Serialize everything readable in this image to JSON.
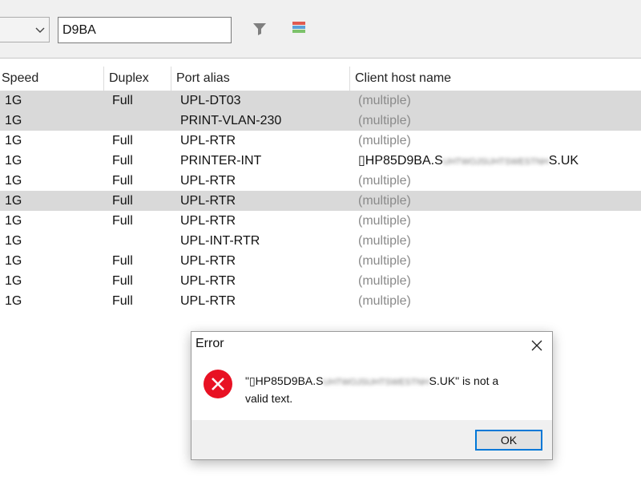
{
  "toolbar": {
    "combo_value": "",
    "filter_value": "D9BA",
    "filter_icon": "funnel-icon",
    "columns_icon": "color-columns-icon"
  },
  "table": {
    "columns": [
      "Speed",
      "Duplex",
      "Port alias",
      "Client host name"
    ],
    "rows": [
      {
        "speed": "1G",
        "duplex": "Full",
        "alias": "UPL-DT03",
        "host": "(multiple)",
        "selected": true
      },
      {
        "speed": "1G",
        "duplex": "",
        "alias": "PRINT-VLAN-230",
        "host": "(multiple)",
        "selected": true
      },
      {
        "speed": "1G",
        "duplex": "Full",
        "alias": "UPL-RTR",
        "host": "(multiple)",
        "selected": false
      },
      {
        "speed": "1G",
        "duplex": "Full",
        "alias": "PRINTER-INT",
        "host": "▯HP85D9BA.S",
        "host_blurred": "UHTWOJSUHTSWESTNH",
        "host_suffix": "S.UK",
        "selected": false
      },
      {
        "speed": "1G",
        "duplex": "Full",
        "alias": "UPL-RTR",
        "host": "(multiple)",
        "selected": false
      },
      {
        "speed": "1G",
        "duplex": "Full",
        "alias": "UPL-RTR",
        "host": "(multiple)",
        "selected": true
      },
      {
        "speed": "1G",
        "duplex": "Full",
        "alias": "UPL-RTR",
        "host": "(multiple)",
        "selected": false
      },
      {
        "speed": "1G",
        "duplex": "",
        "alias": "UPL-INT-RTR",
        "host": "(multiple)",
        "selected": false
      },
      {
        "speed": "1G",
        "duplex": "Full",
        "alias": "UPL-RTR",
        "host": "(multiple)",
        "selected": false
      },
      {
        "speed": "1G",
        "duplex": "Full",
        "alias": "UPL-RTR",
        "host": "(multiple)",
        "selected": false
      },
      {
        "speed": "1G",
        "duplex": "Full",
        "alias": "UPL-RTR",
        "host": "(multiple)",
        "selected": false
      }
    ]
  },
  "dialog": {
    "title": "Error",
    "message_prefix": "\"▯HP85D9BA.S",
    "message_blurred": "UHTWOJSUHTSWESTNH",
    "message_suffix": "S.UK\" is not a",
    "message_line2": "valid text.",
    "ok_label": "OK",
    "icon": "error-icon"
  },
  "colors": {
    "selection": "#d9d9d9",
    "error_red": "#e81123",
    "focus_blue": "#0078d7",
    "dim_text": "#8a8a8a"
  }
}
